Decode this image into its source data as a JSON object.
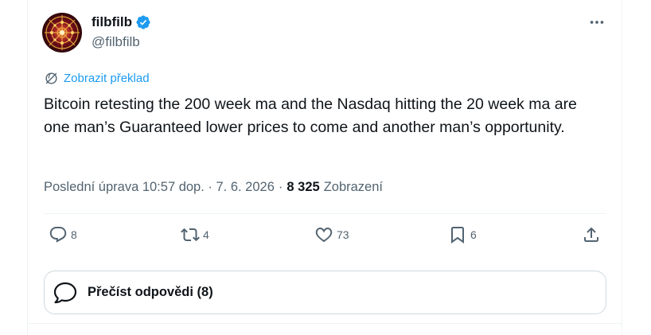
{
  "author": {
    "display_name": "filbfilb",
    "handle": "@filbfilb",
    "verified": true
  },
  "translate_label": "Zobrazit překlad",
  "tweet_text": "Bitcoin retesting the 200 week ma and the Nasdaq hitting the 20 week ma are one man’s Guaranteed lower prices to come and another man’s opportunity.",
  "meta": {
    "edited_timestamp": "Poslední úprava 10:57 dop. · 7. 6. 2026",
    "separator": "·",
    "views_count": "8 325",
    "views_label": "Zobrazení"
  },
  "actions": {
    "replies": "8",
    "reposts": "4",
    "likes": "73",
    "bookmarks": "6"
  },
  "read_replies_label": "Přečíst odpovědi (8)",
  "icons": {
    "more": "more-dots-icon",
    "translate": "translate-globe-icon",
    "reply": "reply-bubble-icon",
    "repost": "repost-arrows-icon",
    "like": "heart-icon",
    "bookmark": "bookmark-icon",
    "share": "share-upload-icon",
    "read_replies": "speech-bubble-icon",
    "verified": "verified-badge-icon"
  },
  "colors": {
    "accent": "#1d9bf0",
    "text": "#0f1419",
    "secondary": "#536471",
    "border": "#cfd9de"
  }
}
